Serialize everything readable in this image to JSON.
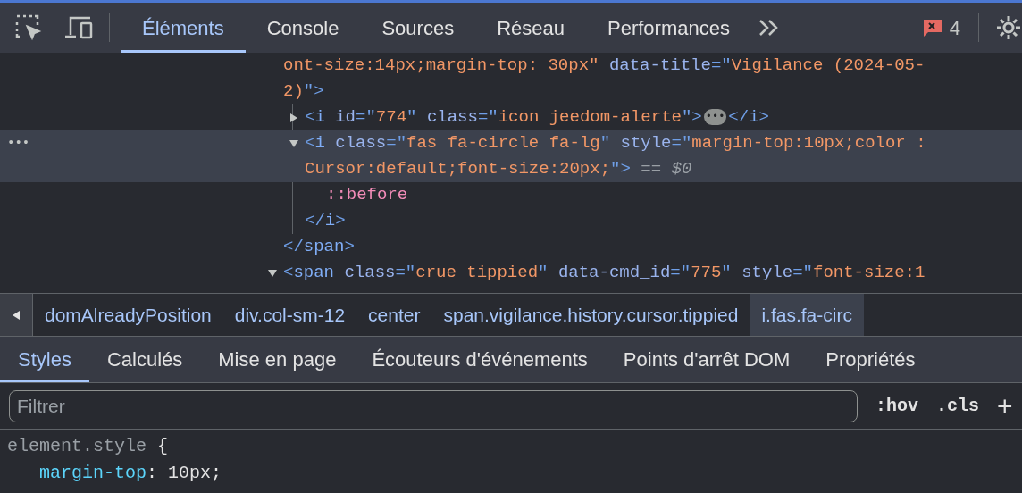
{
  "toolbar": {
    "tabs": [
      {
        "label": "Éléments",
        "selected": true
      },
      {
        "label": "Console",
        "selected": false
      },
      {
        "label": "Sources",
        "selected": false
      },
      {
        "label": "Réseau",
        "selected": false
      },
      {
        "label": "Performances",
        "selected": false
      }
    ],
    "error_count": "4"
  },
  "dom_tree": [
    {
      "selected": false,
      "lines": [
        [
          {
            "kind": "value",
            "text": "ont-size:14px;margin-top: 30px\""
          },
          {
            "kind": "attr",
            "text": "data-title"
          },
          {
            "kind": "punct",
            "text": "=\""
          },
          {
            "kind": "value",
            "text": "Vigilance (2024-05-"
          }
        ],
        [
          {
            "kind": "value",
            "text": "2)"
          },
          {
            "kind": "punct",
            "text": "\">"
          }
        ]
      ],
      "children": [
        {
          "selected": false,
          "expanded": false,
          "lines": [
            [
              {
                "kind": "punct",
                "text": "<"
              },
              {
                "kind": "tag",
                "text": "i"
              },
              {
                "kind": "attr",
                "text": "id"
              },
              {
                "kind": "punct",
                "text": "=\""
              },
              {
                "kind": "value",
                "text": "774"
              },
              {
                "kind": "punct",
                "text": "\""
              },
              {
                "kind": "attr",
                "text": "class"
              },
              {
                "kind": "punct",
                "text": "=\""
              },
              {
                "kind": "value",
                "text": "icon jeedom-alerte"
              },
              {
                "kind": "punct",
                "text": "\">"
              },
              {
                "kind": "ellipsis",
                "text": "•••"
              },
              {
                "kind": "punct",
                "text": "</"
              },
              {
                "kind": "tag",
                "text": "i"
              },
              {
                "kind": "punct",
                "text": ">"
              }
            ]
          ]
        },
        {
          "selected": true,
          "row_marker": "•••",
          "expanded": true,
          "lines": [
            [
              {
                "kind": "punct",
                "text": "<"
              },
              {
                "kind": "tag",
                "text": "i"
              },
              {
                "kind": "attr",
                "text": "class"
              },
              {
                "kind": "punct",
                "text": "=\""
              },
              {
                "kind": "value",
                "text": "fas fa-circle fa-lg"
              },
              {
                "kind": "punct",
                "text": "\""
              },
              {
                "kind": "attr",
                "text": "style"
              },
              {
                "kind": "punct",
                "text": "=\""
              },
              {
                "kind": "value",
                "text": "margin-top:10px;color :"
              }
            ],
            [
              {
                "kind": "value",
                "text": "Cursor:default;font-size:20px;"
              },
              {
                "kind": "punct",
                "text": "\">"
              },
              {
                "kind": "comment",
                "text": "== $0"
              }
            ]
          ],
          "children": [
            {
              "selected": false,
              "lines": [
                [
                  {
                    "kind": "pseudo",
                    "text": "::before"
                  }
                ]
              ]
            }
          ],
          "closing": [
            {
              "kind": "punct",
              "text": "</"
            },
            {
              "kind": "tag",
              "text": "i"
            },
            {
              "kind": "punct",
              "text": ">"
            }
          ]
        }
      ],
      "closing": [
        {
          "kind": "punct",
          "text": "</"
        },
        {
          "kind": "tag",
          "text": "span"
        },
        {
          "kind": "punct",
          "text": ">"
        }
      ]
    },
    {
      "selected": false,
      "expanded": true,
      "lines": [
        [
          {
            "kind": "punct",
            "text": "<"
          },
          {
            "kind": "tag",
            "text": "span"
          },
          {
            "kind": "attr",
            "text": "class"
          },
          {
            "kind": "punct",
            "text": "=\""
          },
          {
            "kind": "value",
            "text": "crue tippied"
          },
          {
            "kind": "punct",
            "text": "\""
          },
          {
            "kind": "attr",
            "text": "data-cmd_id"
          },
          {
            "kind": "punct",
            "text": "=\""
          },
          {
            "kind": "value",
            "text": "775"
          },
          {
            "kind": "punct",
            "text": "\""
          },
          {
            "kind": "attr",
            "text": "style"
          },
          {
            "kind": "punct",
            "text": "=\""
          },
          {
            "kind": "value",
            "text": "font-size:1"
          }
        ]
      ]
    }
  ],
  "breadcrumbs": [
    {
      "label": "domAlreadyPosition",
      "selected": false
    },
    {
      "label": "div.col-sm-12",
      "selected": false
    },
    {
      "label": "center",
      "selected": false
    },
    {
      "label": "span.vigilance.history.cursor.tippied",
      "selected": false
    },
    {
      "label": "i.fas.fa-circ",
      "selected": true
    }
  ],
  "styles_tabs": [
    {
      "label": "Styles",
      "selected": true
    },
    {
      "label": "Calculés",
      "selected": false
    },
    {
      "label": "Mise en page",
      "selected": false
    },
    {
      "label": "Écouteurs d'événements",
      "selected": false
    },
    {
      "label": "Points d'arrêt DOM",
      "selected": false
    },
    {
      "label": "Propriétés",
      "selected": false
    }
  ],
  "filter": {
    "placeholder": "Filtrer",
    "hov": ":hov",
    "cls": ".cls",
    "add": "+"
  },
  "rules": [
    {
      "selector": "element.style",
      "brace": "{",
      "declarations": [
        {
          "property": "margin-top",
          "colon": ":",
          "value": "10px;"
        }
      ]
    }
  ]
}
